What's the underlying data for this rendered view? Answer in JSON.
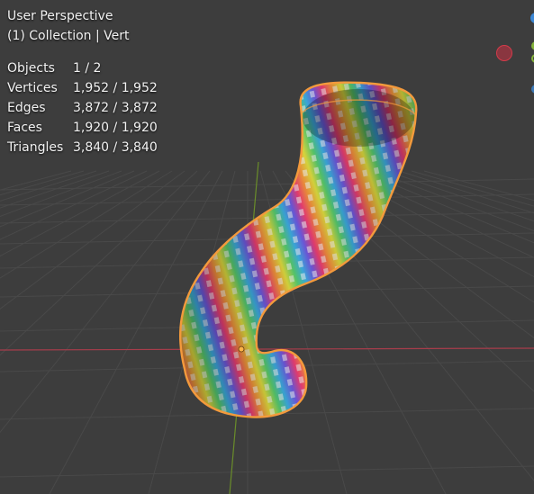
{
  "viewport": {
    "view_name": "User Perspective",
    "collection_info": "(1) Collection | Vert"
  },
  "stats": [
    {
      "label": "Objects",
      "value": "1 / 2"
    },
    {
      "label": "Vertices",
      "value": "1,952 / 1,952"
    },
    {
      "label": "Edges",
      "value": "3,872 / 3,872"
    },
    {
      "label": "Faces",
      "value": "1,920 / 1,920"
    },
    {
      "label": "Triangles",
      "value": "3,840 / 3,840"
    }
  ],
  "colors": {
    "background": "#3d3d3d",
    "grid": "#494949",
    "x_axis": "#a83d4b",
    "y_axis": "#6a8d2a",
    "selection_outline": "#f39a3c",
    "gizmo_x": "#d43b4a",
    "gizmo_y": "#84b33a",
    "gizmo_z": "#3c88d6"
  },
  "icons": {
    "navigation_gizmo": "axis-gizmo-icon",
    "origin": "origin-dot-icon"
  }
}
